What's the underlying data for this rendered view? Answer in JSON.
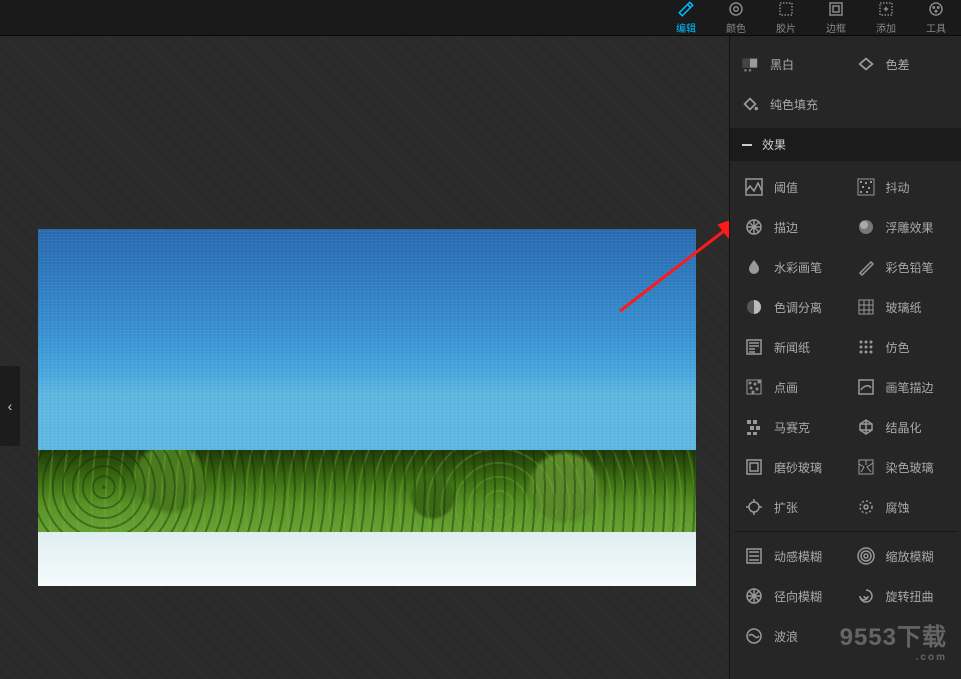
{
  "toolbar": {
    "tabs": [
      {
        "id": "edit",
        "label": "编辑"
      },
      {
        "id": "color",
        "label": "颜色"
      },
      {
        "id": "film",
        "label": "胶片"
      },
      {
        "id": "frame",
        "label": "边框"
      },
      {
        "id": "add",
        "label": "添加"
      },
      {
        "id": "tools",
        "label": "工具"
      }
    ]
  },
  "pre_effects": {
    "bw": "黑白",
    "ca": "色差",
    "fill": "纯色填充"
  },
  "section": {
    "title": "效果"
  },
  "effects": {
    "threshold": "阈值",
    "dither": "抖动",
    "stroke": "描边",
    "emboss": "浮雕效果",
    "watercolor": "水彩画笔",
    "colorpencil": "彩色铅笔",
    "posterize": "色调分离",
    "cellophane": "玻璃纸",
    "newsprint": "新闻纸",
    "halftone": "仿色",
    "pointillize": "点画",
    "brushstroke": "画笔描边",
    "mosaic": "马赛克",
    "crystallize": "结晶化",
    "frosted": "磨砂玻璃",
    "stained": "染色玻璃",
    "dilate": "扩张",
    "erode": "腐蚀",
    "motionblur": "动感模糊",
    "zoomblur": "缩放模糊",
    "radialblur": "径向模糊",
    "twirl": "旋转扭曲",
    "wave": "波浪"
  },
  "watermark": {
    "text": "9553下载",
    "sub": ".com"
  }
}
